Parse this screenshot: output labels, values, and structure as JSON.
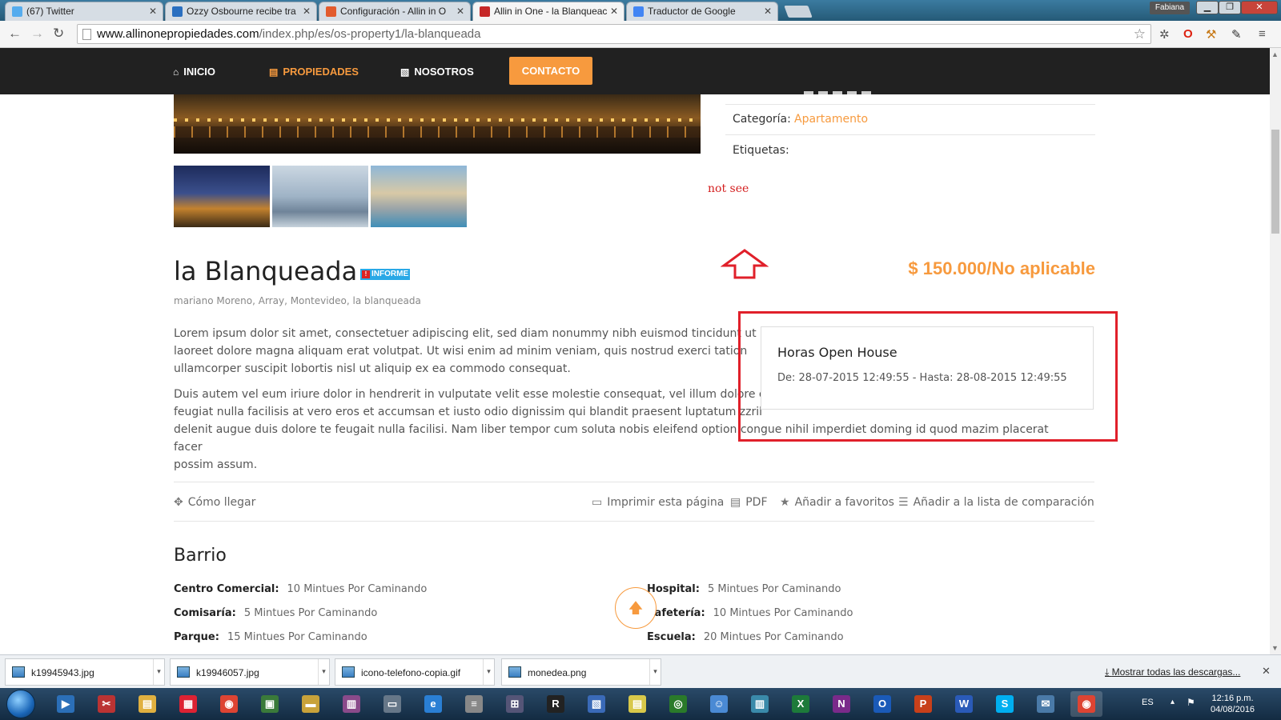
{
  "browser": {
    "tabs": [
      {
        "label": "(67) Twitter",
        "active": false,
        "icon_color": "#55acee"
      },
      {
        "label": "Ozzy Osbourne recibe tra",
        "active": false,
        "icon_color": "#2a6fc0"
      },
      {
        "label": "Configuración - Allin in O",
        "active": false,
        "icon_color": "#e25b2d"
      },
      {
        "label": "Allin in One - la Blanqueac",
        "active": true,
        "icon_color": "#c62828"
      },
      {
        "label": "Traductor de Google",
        "active": false,
        "icon_color": "#4285f4"
      }
    ],
    "user_label": "Fabiana",
    "url_host": "www.allinonepropiedades.com",
    "url_path": "/index.php/es/os-property1/la-blanqueada"
  },
  "site_nav": {
    "items": [
      {
        "label": "INICIO",
        "icon": "home-icon"
      },
      {
        "label": "PROPIEDADES",
        "icon": "building-icon"
      },
      {
        "label": "NOSOTROS",
        "icon": "document-icon"
      }
    ],
    "contact_label": "CONTACTO"
  },
  "sidebar": {
    "category_label": "Categoría:",
    "category_value": "Apartamento",
    "tags_label": "Etiquetas:"
  },
  "annotation": {
    "text": "not see"
  },
  "property": {
    "title": "la Blanqueada",
    "badge": "INFORME",
    "price": "$ 150.000/No aplicable",
    "address": "mariano Moreno, Array, Montevideo, la blanqueada",
    "para1_lines": [
      "Lorem ipsum dolor sit amet, consectetuer adipiscing elit, sed diam nonummy nibh euismod tincidunt ut",
      "laoreet dolore magna aliquam erat volutpat. Ut wisi enim ad minim veniam, quis nostrud exerci tation",
      "ullamcorper suscipit lobortis nisl ut aliquip ex ea commodo consequat."
    ],
    "para2_lines": [
      "Duis autem vel eum iriure dolor in hendrerit in vulputate velit esse molestie consequat, vel illum dolore eu",
      "feugiat nulla facilisis at vero eros et accumsan et iusto odio dignissim qui blandit praesent luptatum zzril",
      "delenit augue duis dolore te feugait nulla facilisi. Nam liber tempor cum soluta nobis eleifend option congue nihil imperdiet doming id quod mazim placerat facer",
      "possim assum."
    ]
  },
  "open_house": {
    "title": "Horas Open House",
    "dates": "De: 28-07-2015 12:49:55 - Hasta: 28-08-2015 12:49:55"
  },
  "actions": {
    "directions": "Cómo llegar",
    "print": "Imprimir esta página",
    "pdf": "PDF",
    "favorites": "Añadir a favoritos",
    "compare": "Añadir a la lista de comparación"
  },
  "neighborhood": {
    "title": "Barrio",
    "left": [
      {
        "label": "Centro Comercial:",
        "value": "10 Mintues Por Caminando"
      },
      {
        "label": "Comisaría:",
        "value": "5 Mintues Por Caminando"
      },
      {
        "label": "Parque:",
        "value": "15 Mintues Por Caminando"
      }
    ],
    "right": [
      {
        "label": "Hospital:",
        "value": "5 Mintues Por Caminando"
      },
      {
        "label": "Cafetería:",
        "value": "10 Mintues Por Caminando"
      },
      {
        "label": "Escuela:",
        "value": "20 Mintues Por Caminando"
      }
    ]
  },
  "downloads": {
    "items": [
      "k19945943.jpg",
      "k19946057.jpg",
      "icono-telefono-copia.gif",
      "monedea.png"
    ],
    "show_all": "Mostrar todas las descargas..."
  },
  "taskbar": {
    "lang": "ES",
    "time": "12:16 p.m.",
    "date": "04/08/2016",
    "apps": [
      {
        "name": "media-player-icon",
        "color": "#2b6fb8",
        "glyph": "▶"
      },
      {
        "name": "snipping-tool-icon",
        "color": "#b33",
        "glyph": "✂"
      },
      {
        "name": "file-explorer-icon",
        "color": "#e0b040",
        "glyph": "▤"
      },
      {
        "name": "apps-grid-icon",
        "color": "#d23",
        "glyph": "▦"
      },
      {
        "name": "chrome-icon",
        "color": "#dd4433",
        "glyph": "◉"
      },
      {
        "name": "file-manager-icon",
        "color": "#3a7a3a",
        "glyph": "▣"
      },
      {
        "name": "notes-icon",
        "color": "#c8a23a",
        "glyph": "▬"
      },
      {
        "name": "archive-icon",
        "color": "#8a4a8a",
        "glyph": "▥"
      },
      {
        "name": "printer-icon",
        "color": "#667788",
        "glyph": "▭"
      },
      {
        "name": "internet-explorer-icon",
        "color": "#2a7fd4",
        "glyph": "e"
      },
      {
        "name": "document-viewer-icon",
        "color": "#888",
        "glyph": "≡"
      },
      {
        "name": "network-icon",
        "color": "#557",
        "glyph": "⊞"
      },
      {
        "name": "remote-icon",
        "color": "#222",
        "glyph": "R"
      },
      {
        "name": "remote-desktop-icon",
        "color": "#3a6ab8",
        "glyph": "▧"
      },
      {
        "name": "sticky-notes-icon",
        "color": "#d8c84a",
        "glyph": "▤"
      },
      {
        "name": "eye-app-icon",
        "color": "#2a7a2a",
        "glyph": "◎"
      },
      {
        "name": "messenger-icon",
        "color": "#4a8ad4",
        "glyph": "☺"
      },
      {
        "name": "city-app-icon",
        "color": "#3a8aaa",
        "glyph": "▥"
      },
      {
        "name": "excel-icon",
        "color": "#1d7a3a",
        "glyph": "X"
      },
      {
        "name": "onenote-icon",
        "color": "#7a2a8a",
        "glyph": "N"
      },
      {
        "name": "outlook-icon",
        "color": "#1a5ab8",
        "glyph": "O"
      },
      {
        "name": "powerpoint-icon",
        "color": "#c8401a",
        "glyph": "P"
      },
      {
        "name": "word-icon",
        "color": "#2a5ab8",
        "glyph": "W"
      },
      {
        "name": "skype-icon",
        "color": "#00aff0",
        "glyph": "S"
      },
      {
        "name": "mail-app-icon",
        "color": "#4a7aa8",
        "glyph": "✉"
      },
      {
        "name": "chrome-active-icon",
        "color": "#dd4433",
        "glyph": "◉"
      }
    ]
  },
  "colors": {
    "accent": "#f79a3e",
    "nav_bg": "#212121",
    "annotation_red": "#e0202a"
  }
}
